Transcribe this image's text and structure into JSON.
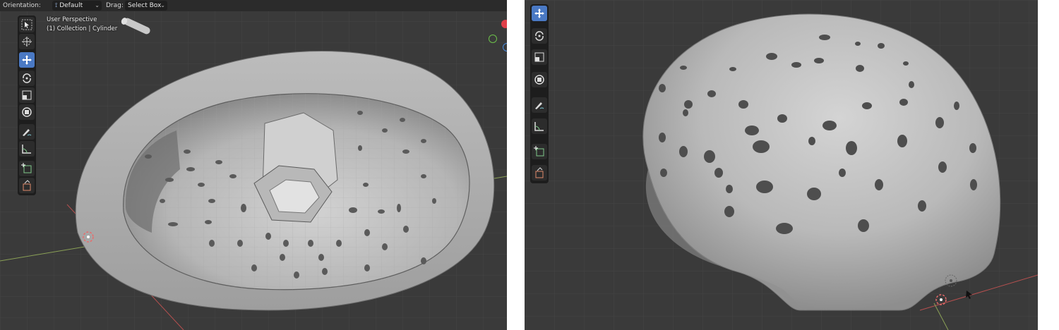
{
  "header": {
    "orientation_label": "Orientation:",
    "orientation_value": "Default",
    "drag_label": "Drag:",
    "drag_value": "Select Box"
  },
  "viewport_overlay": {
    "perspective": "User Perspective",
    "collection_path": "(1) Collection | Cylinder"
  },
  "left_toolbar": [
    {
      "icon": "select-box-icon",
      "active": false
    },
    {
      "icon": "cursor-icon",
      "active": false
    },
    {
      "icon": "move-icon",
      "active": true
    },
    {
      "icon": "rotate-icon",
      "active": false
    },
    {
      "icon": "scale-icon",
      "active": false
    },
    {
      "icon": "transform-icon",
      "active": false
    },
    {
      "icon": "annotate-icon",
      "active": false
    },
    {
      "icon": "measure-icon",
      "active": false
    },
    {
      "icon": "add-cube-icon",
      "active": false
    },
    {
      "icon": "extrude-icon",
      "active": false
    }
  ],
  "right_toolbar": [
    {
      "icon": "move-icon",
      "active": true
    },
    {
      "icon": "rotate-icon",
      "active": false
    },
    {
      "icon": "scale-icon",
      "active": false
    },
    {
      "icon": "transform-icon",
      "active": false
    },
    {
      "icon": "annotate-icon",
      "active": false
    },
    {
      "icon": "measure-icon",
      "active": false
    },
    {
      "icon": "add-cube-icon",
      "active": false
    },
    {
      "icon": "extrude-icon",
      "active": false
    }
  ],
  "colors": {
    "viewport_bg": "#3a3a3a",
    "grid": "#454545",
    "header_bg": "#2b2b2b",
    "toolbar_bg": "#1d1d1d",
    "active_tool": "#4a79c4",
    "mesh_light": "#c7c7c7",
    "mesh_dark": "#8a8a8a",
    "axis_x": "#b5504f",
    "axis_y": "#7aa04a",
    "gizmo_red": "#e0404a",
    "gizmo_green": "#6cc04a",
    "gizmo_blue": "#4a8de0"
  }
}
